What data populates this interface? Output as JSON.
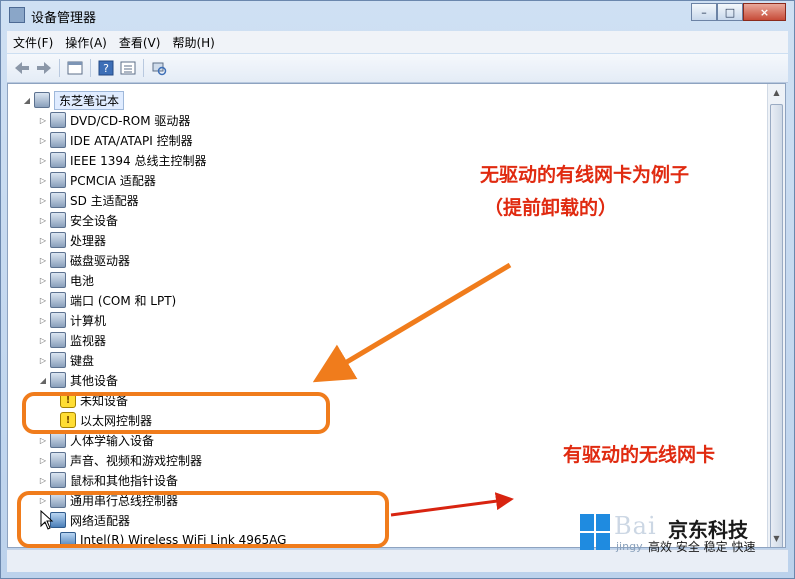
{
  "window": {
    "title": "设备管理器",
    "buttons": {
      "minimize": "–",
      "maximize": "□",
      "close": "×"
    }
  },
  "menu": [
    "文件(F)",
    "操作(A)",
    "查看(V)",
    "帮助(H)"
  ],
  "toolbar": [
    "back-arrow-icon",
    "forward-arrow-icon",
    "properties-icon",
    "help-icon",
    "details-icon",
    "scan-hardware-icon"
  ],
  "tree": {
    "root": "东芝笔记本",
    "items": [
      {
        "label": "DVD/CD-ROM 驱动器",
        "icon": "dvd-drive-icon"
      },
      {
        "label": "IDE ATA/ATAPI 控制器",
        "icon": "ide-controller-icon"
      },
      {
        "label": "IEEE 1394 总线主控制器",
        "icon": "ieee1394-icon"
      },
      {
        "label": "PCMCIA 适配器",
        "icon": "pcmcia-icon"
      },
      {
        "label": "SD 主适配器",
        "icon": "sd-adapter-icon"
      },
      {
        "label": "安全设备",
        "icon": "security-device-icon"
      },
      {
        "label": "处理器",
        "icon": "processor-icon"
      },
      {
        "label": "磁盘驱动器",
        "icon": "disk-drive-icon"
      },
      {
        "label": "电池",
        "icon": "battery-icon"
      },
      {
        "label": "端口 (COM 和 LPT)",
        "icon": "port-icon"
      },
      {
        "label": "计算机",
        "icon": "computer-icon"
      },
      {
        "label": "监视器",
        "icon": "monitor-icon"
      },
      {
        "label": "键盘",
        "icon": "keyboard-icon"
      },
      {
        "label": "其他设备",
        "icon": "other-devices-icon",
        "expanded": true
      },
      {
        "label": "未知设备",
        "icon": "warning-icon",
        "child": true
      },
      {
        "label": "以太网控制器",
        "icon": "warning-icon",
        "child": true
      },
      {
        "label": "人体学输入设备",
        "icon": "hid-icon"
      },
      {
        "label": "声音、视频和游戏控制器",
        "icon": "sound-icon"
      },
      {
        "label": "鼠标和其他指针设备",
        "icon": "mouse-icon"
      },
      {
        "label": "通用串行总线控制器",
        "icon": "usb-icon"
      },
      {
        "label": "网络适配器",
        "icon": "network-adapter-icon",
        "expanded": true
      },
      {
        "label": "Intel(R) Wireless WiFi Link 4965AG",
        "icon": "network-adapter-icon",
        "child": true
      }
    ]
  },
  "annotations": {
    "wired_note_line1": "无驱动的有线网卡为例子",
    "wired_note_line2": "（提前卸载的）",
    "wireless_note": "有驱动的无线网卡",
    "accent_orange": "#f07c1c",
    "accent_red": "#e02a10"
  },
  "watermark": {
    "brand": "Bai",
    "name": "京东科技",
    "url": "jingy",
    "slogan": "高效 安全 稳定 快速"
  }
}
